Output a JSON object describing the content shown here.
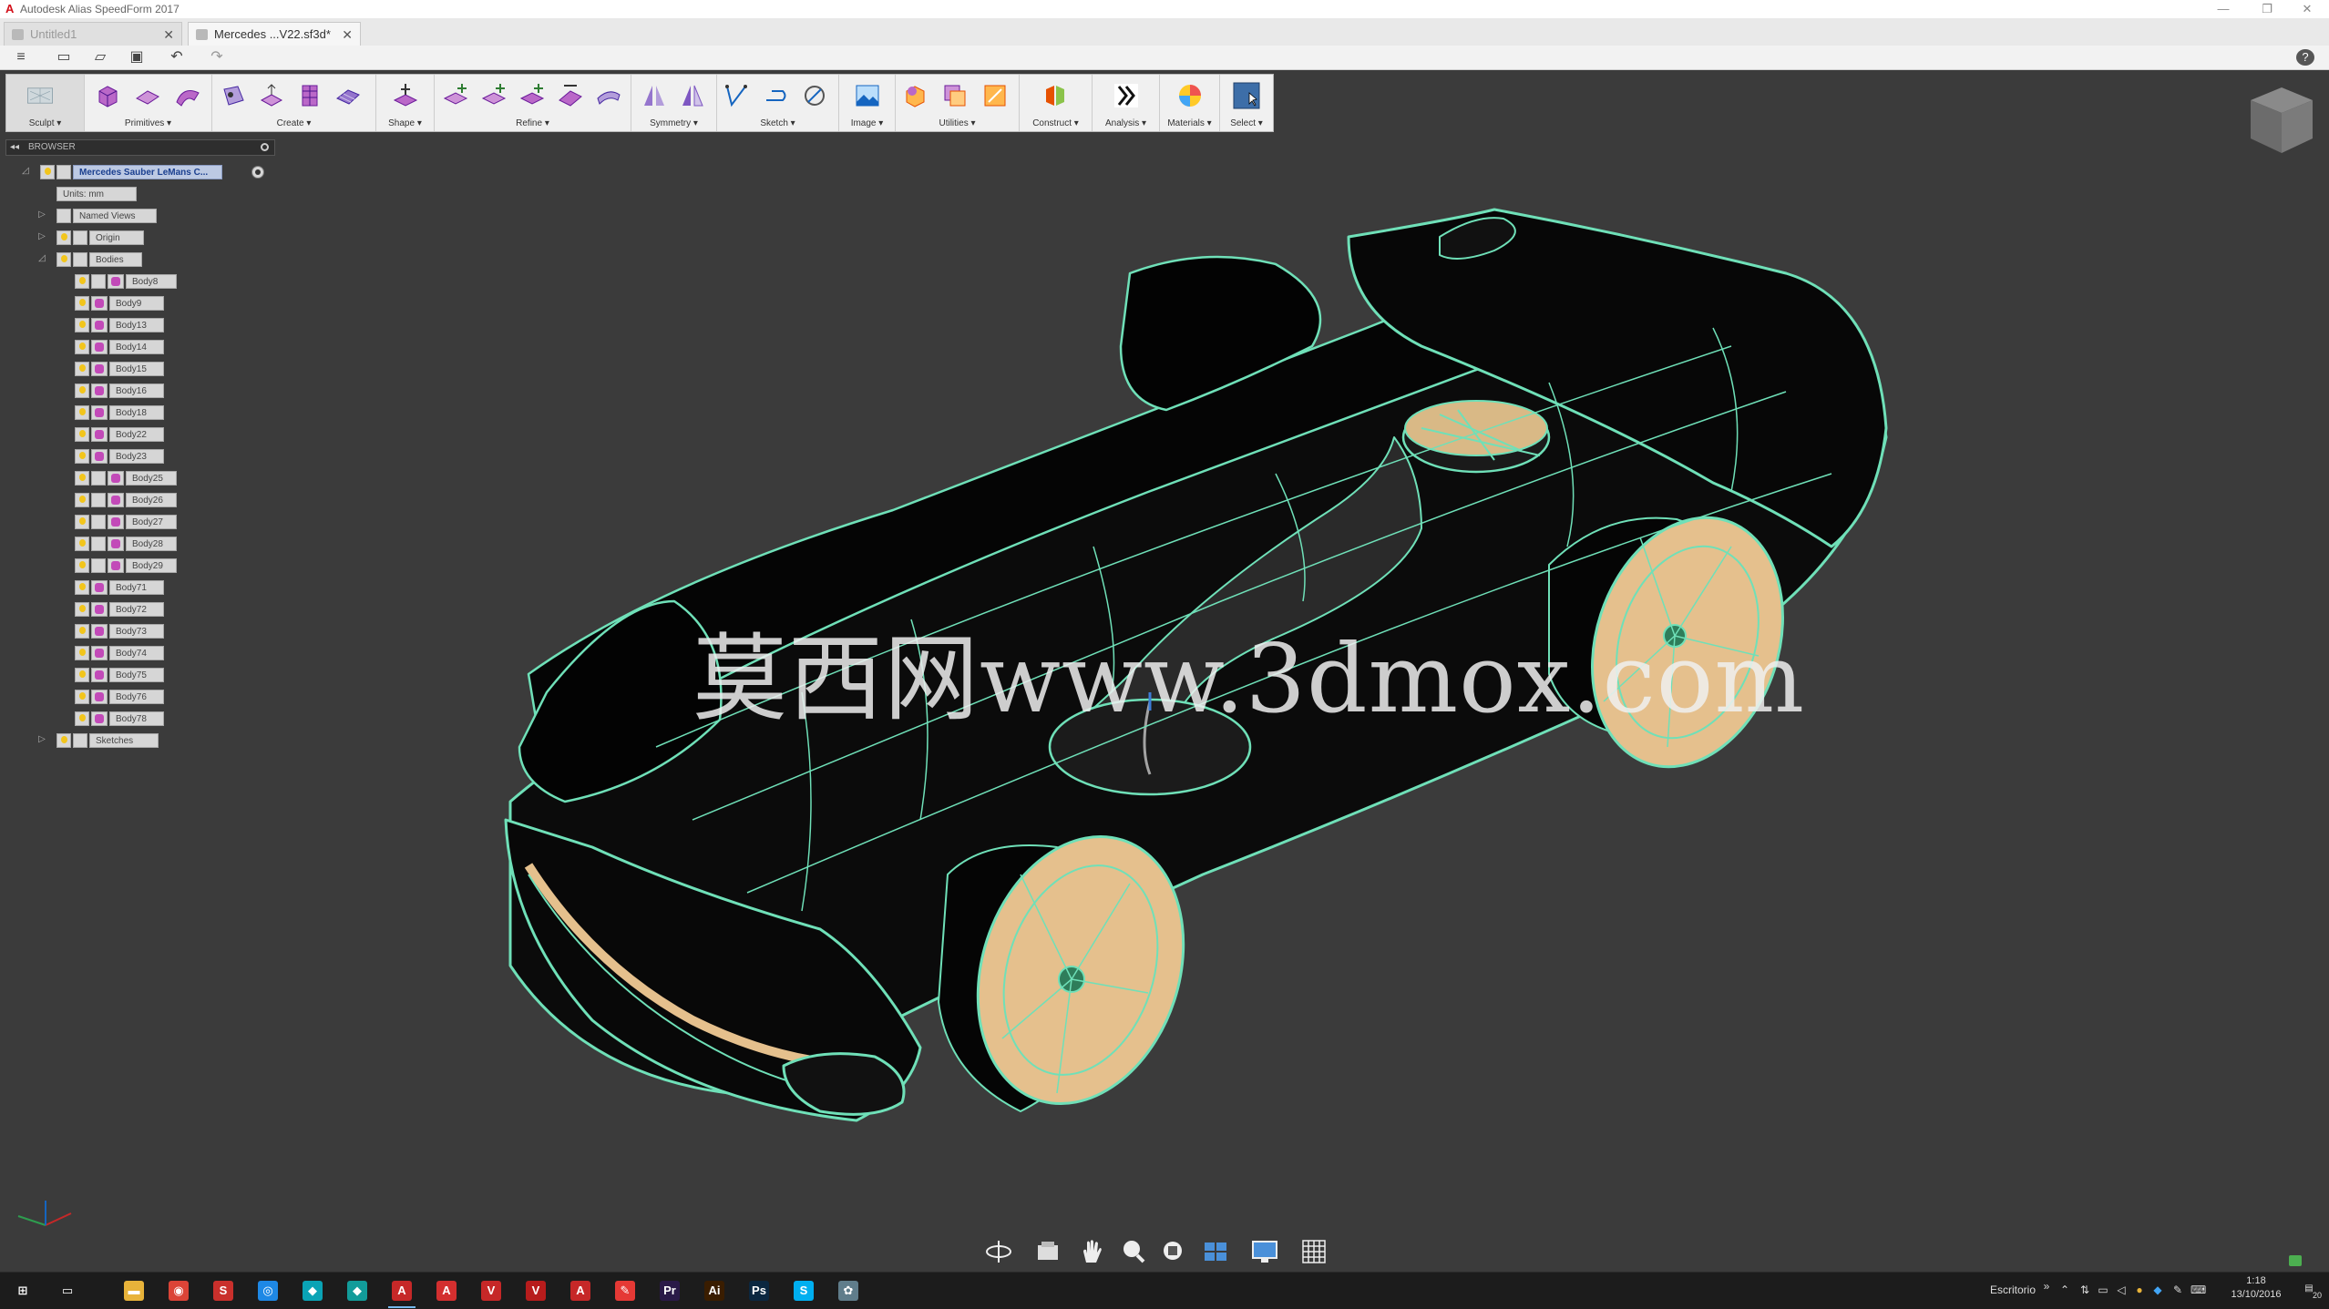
{
  "window": {
    "title": "Autodesk Alias SpeedForm 2017",
    "minimize": "—",
    "restore": "❐",
    "close": "✕"
  },
  "tabs": [
    {
      "label": "Untitled1",
      "close": "✕"
    },
    {
      "label": "Mercedes ...V22.sf3d*",
      "close": "✕"
    }
  ],
  "quick_access": {
    "menu": "≡",
    "new": "▭",
    "open": "▱",
    "save": "▣",
    "undo": "↶",
    "redo": "↷",
    "help": "?"
  },
  "ribbon": {
    "groups": [
      {
        "label": "Sculpt ▾"
      },
      {
        "label": "Primitives ▾"
      },
      {
        "label": "Create ▾"
      },
      {
        "label": "Shape ▾"
      },
      {
        "label": "Refine ▾"
      },
      {
        "label": "Symmetry ▾"
      },
      {
        "label": "Sketch ▾"
      },
      {
        "label": "Image ▾"
      },
      {
        "label": "Utilities ▾"
      },
      {
        "label": "Construct ▾"
      },
      {
        "label": "Analysis ▾"
      },
      {
        "label": "Materials ▾"
      },
      {
        "label": "Select ▾"
      }
    ]
  },
  "browser": {
    "header": "BROWSER",
    "collapse": "◂◂",
    "root": "Mercedes Sauber LeMans C...",
    "units": "Units: mm",
    "named_views": "Named Views",
    "origin": "Origin",
    "bodies": "Bodies",
    "sketches": "Sketches",
    "body_items": [
      {
        "label": "Body8",
        "extra": true
      },
      {
        "label": "Body9",
        "extra": false
      },
      {
        "label": "Body13",
        "extra": false
      },
      {
        "label": "Body14",
        "extra": false
      },
      {
        "label": "Body15",
        "extra": false
      },
      {
        "label": "Body16",
        "extra": false
      },
      {
        "label": "Body18",
        "extra": false
      },
      {
        "label": "Body22",
        "extra": false
      },
      {
        "label": "Body23",
        "extra": false
      },
      {
        "label": "Body25",
        "extra": true
      },
      {
        "label": "Body26",
        "extra": true
      },
      {
        "label": "Body27",
        "extra": true
      },
      {
        "label": "Body28",
        "extra": true
      },
      {
        "label": "Body29",
        "extra": true
      },
      {
        "label": "Body71",
        "extra": false
      },
      {
        "label": "Body72",
        "extra": false
      },
      {
        "label": "Body73",
        "extra": false
      },
      {
        "label": "Body74",
        "extra": false
      },
      {
        "label": "Body75",
        "extra": false
      },
      {
        "label": "Body76",
        "extra": false
      },
      {
        "label": "Body78",
        "extra": false
      }
    ]
  },
  "viewport": {
    "watermark": "莫西网www.3dmox.com",
    "background": "#3b3b3b",
    "wire_color": "#6fe0b8",
    "wheel_color": "#e5c08d"
  },
  "taskbar": {
    "tray_label": "Escritorio",
    "tray_chevron": "»",
    "time": "1:18",
    "date": "13/10/2016",
    "notif_count": "20",
    "apps": [
      {
        "icon": "start-icon",
        "glyph": "⊞",
        "color": "#1c1c1c"
      },
      {
        "icon": "task-view-icon",
        "glyph": "▭",
        "color": "#1c1c1c"
      },
      {
        "icon": "file-explorer-icon",
        "glyph": "▬",
        "color": "#e8b33a"
      },
      {
        "icon": "chrome-icon",
        "glyph": "◉",
        "color": "#db4437"
      },
      {
        "icon": "speedform-icon",
        "glyph": "S",
        "color": "#c9302c"
      },
      {
        "icon": "app-blue-icon",
        "glyph": "◎",
        "color": "#1e88e5"
      },
      {
        "icon": "app-teal-icon",
        "glyph": "◆",
        "color": "#0aa3b5"
      },
      {
        "icon": "app-teal2-icon",
        "glyph": "◆",
        "color": "#129c9a"
      },
      {
        "icon": "alias-icon",
        "glyph": "A",
        "color": "#c62828"
      },
      {
        "icon": "alias2-icon",
        "glyph": "A",
        "color": "#d32f2f"
      },
      {
        "icon": "vred-icon",
        "glyph": "V",
        "color": "#c62828"
      },
      {
        "icon": "vred2-icon",
        "glyph": "V",
        "color": "#b71c1c"
      },
      {
        "icon": "autocad-icon",
        "glyph": "A",
        "color": "#c62828"
      },
      {
        "icon": "pencil-icon",
        "glyph": "✎",
        "color": "#e53935"
      },
      {
        "icon": "premiere-icon",
        "glyph": "Pr",
        "color": "#2a1a48"
      },
      {
        "icon": "illustrator-icon",
        "glyph": "Ai",
        "color": "#3a1d00"
      },
      {
        "icon": "photoshop-icon",
        "glyph": "Ps",
        "color": "#0b2740"
      },
      {
        "icon": "skype-icon",
        "glyph": "S",
        "color": "#00aff0"
      },
      {
        "icon": "app-misc-icon",
        "glyph": "✿",
        "color": "#607d8b"
      }
    ]
  }
}
